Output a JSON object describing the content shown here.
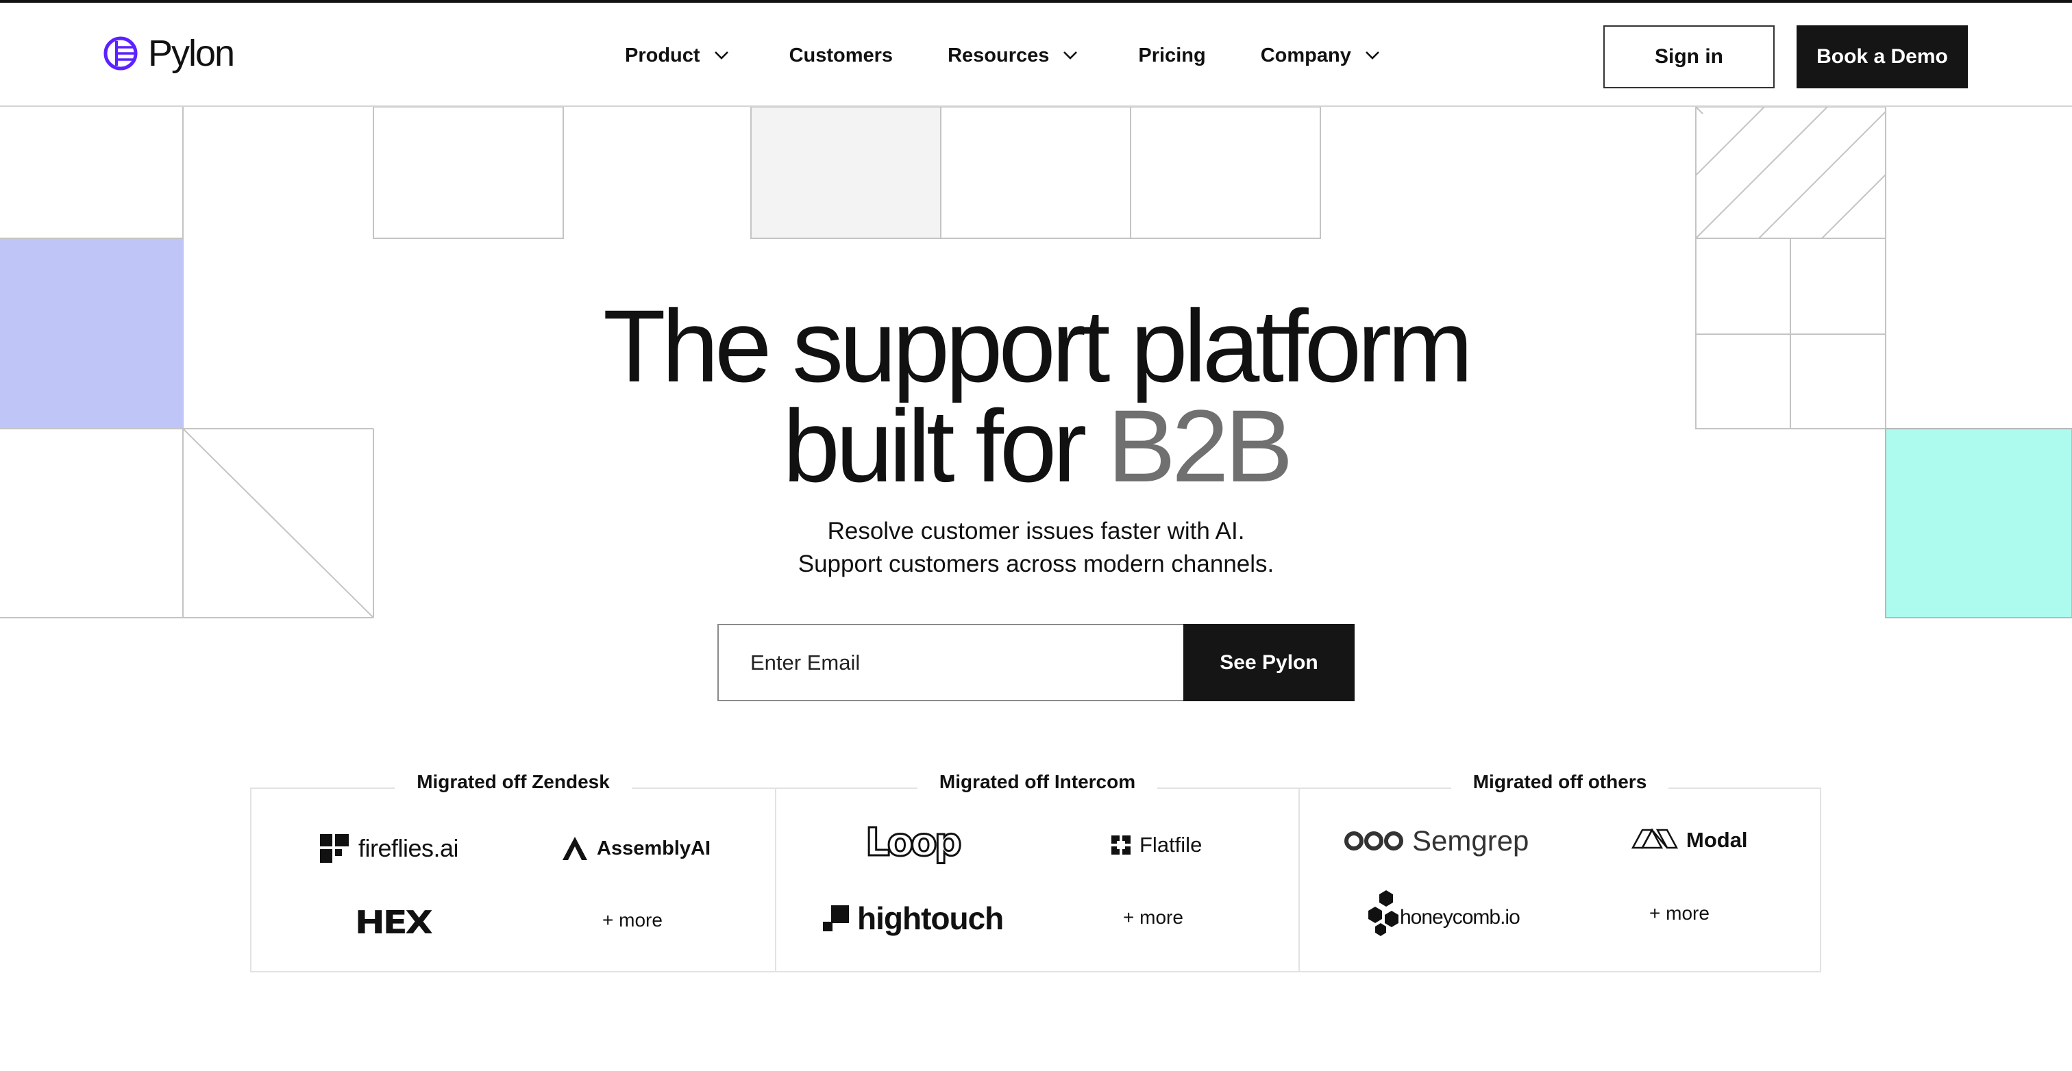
{
  "brand": {
    "name": "Pylon",
    "accent_color": "#5b21ff"
  },
  "nav": {
    "items": [
      {
        "label": "Product",
        "has_dropdown": true
      },
      {
        "label": "Customers",
        "has_dropdown": false
      },
      {
        "label": "Resources",
        "has_dropdown": true
      },
      {
        "label": "Pricing",
        "has_dropdown": false
      },
      {
        "label": "Company",
        "has_dropdown": true
      }
    ],
    "signin_label": "Sign in",
    "demo_label": "Book a Demo"
  },
  "hero": {
    "title_line1": "The support platform",
    "title_line2_prefix": "built for ",
    "title_line2_accent": "B2B",
    "subtitle_line1": "Resolve customer issues faster with AI.",
    "subtitle_line2": "Support customers across modern channels.",
    "email_placeholder": "Enter Email",
    "cta_label": "See Pylon"
  },
  "migrations": [
    {
      "title": "Migrated off Zendesk",
      "logos": [
        "fireflies.ai",
        "AssemblyAI",
        "HEX"
      ],
      "more_label": "+ more"
    },
    {
      "title": "Migrated off Intercom",
      "logos": [
        "Loop",
        "Flatfile",
        "hightouch"
      ],
      "more_label": "+ more"
    },
    {
      "title": "Migrated off others",
      "logos": [
        "Semgrep",
        "Modal",
        "honeycomb.io"
      ],
      "more_label": "+ more"
    }
  ],
  "colors": {
    "deco_lavender": "#c0c5f7",
    "deco_mint": "#adfbef",
    "deco_gray": "#f3f3f3",
    "button_dark": "#151515",
    "accent_text": "#707070"
  }
}
